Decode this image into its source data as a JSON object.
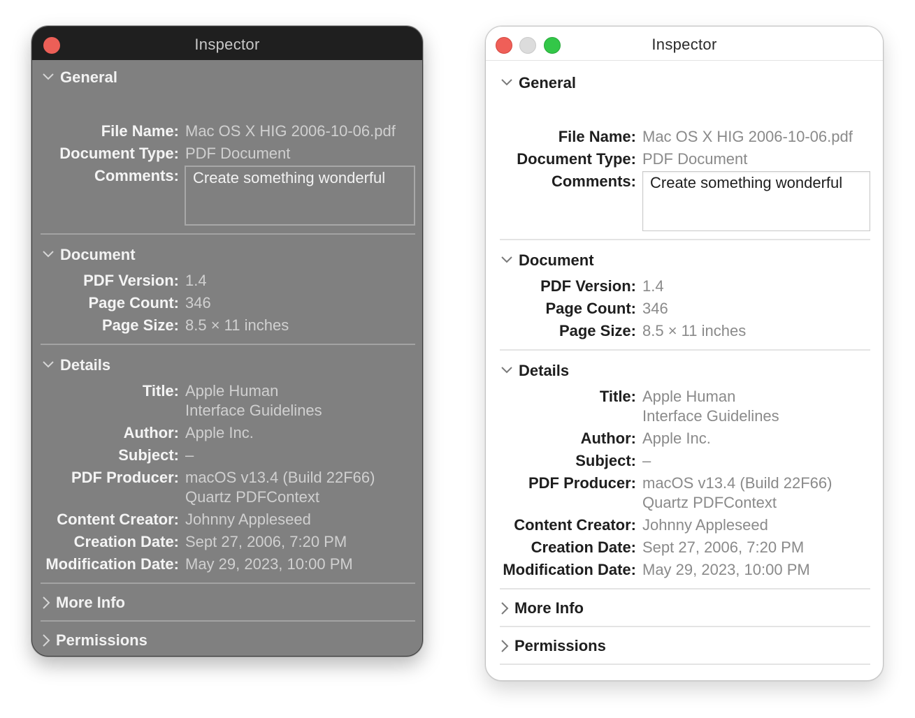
{
  "window_title": "Inspector",
  "sections": {
    "general": "General",
    "document": "Document",
    "details": "Details",
    "more_info": "More Info",
    "permissions": "Permissions"
  },
  "labels": {
    "file_name": "File Name:",
    "document_type": "Document Type:",
    "comments": "Comments:",
    "pdf_version": "PDF Version:",
    "page_count": "Page Count:",
    "page_size": "Page Size:",
    "title": "Title:",
    "author": "Author:",
    "subject": "Subject:",
    "pdf_producer": "PDF Producer:",
    "content_creator": "Content Creator:",
    "creation_date": "Creation Date:",
    "modification_date": "Modification Date:"
  },
  "values": {
    "file_name": "Mac OS X HIG 2006-10-06.pdf",
    "document_type": "PDF Document",
    "comments": "Create something wonderful",
    "pdf_version": "1.4",
    "page_count": "346",
    "page_size": "8.5 × 11 inches",
    "title_line1": "Apple Human",
    "title_line2": "Interface Guidelines",
    "author": "Apple Inc.",
    "subject": "–",
    "pdf_producer_line1": "macOS v13.4 (Build 22F66)",
    "pdf_producer_line2": "Quartz PDFContext",
    "content_creator": "Johnny Appleseed",
    "creation_date": "Sept 27, 2006, 7:20 PM",
    "modification_date": "May 29, 2023, 10:00 PM"
  },
  "colors": {
    "dark_window_bg": "#808080",
    "dark_titlebar": "#1f1f1f",
    "close_red": "#ec5f57",
    "zoom_green": "#33c748",
    "minimize_gray": "#dcdcdc"
  },
  "icons": {
    "expanded": "chevron-down-icon",
    "collapsed": "chevron-right-icon"
  }
}
